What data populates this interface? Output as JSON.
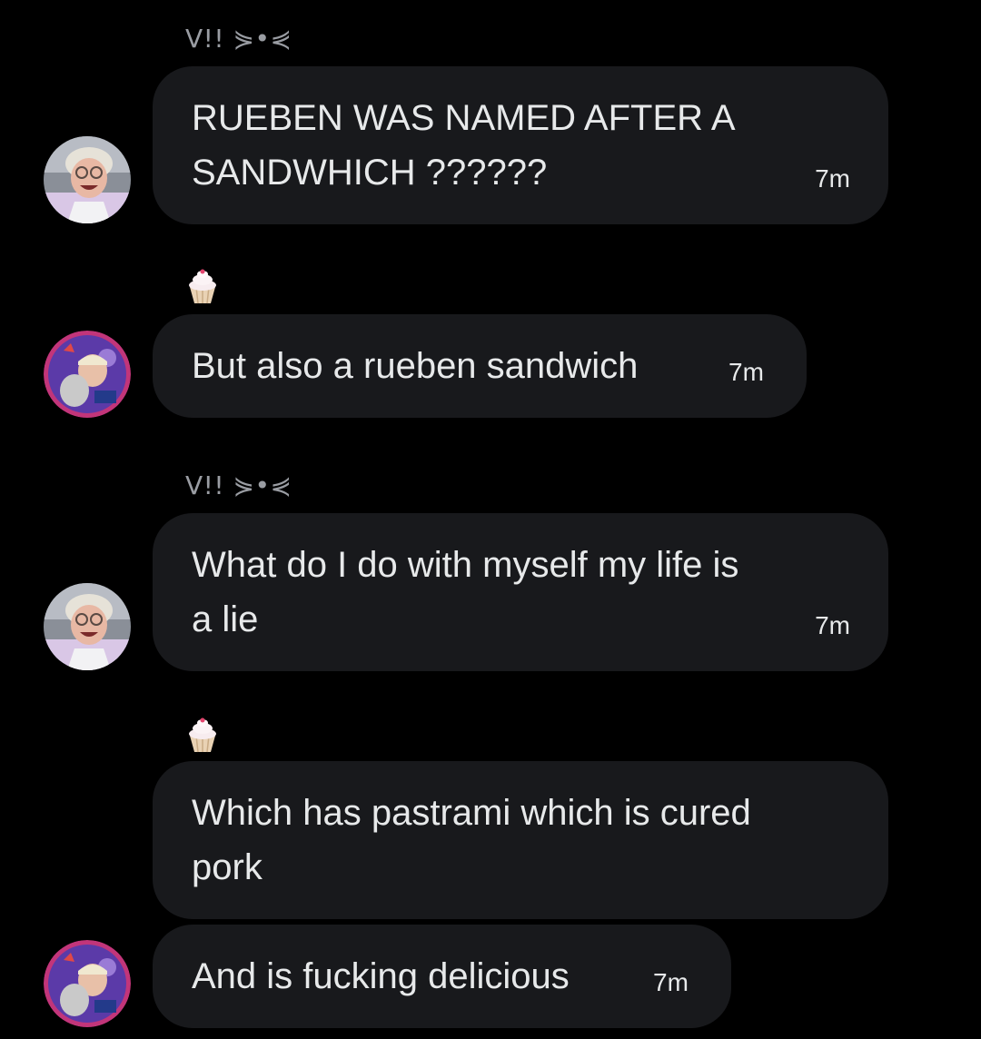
{
  "conversation": {
    "messages": [
      {
        "sender": "V!! ⋟•⋞",
        "text": "RUEBEN WAS NAMED AFTER A\nSANDWHICH ??????",
        "time": "7m"
      },
      {
        "sender_icon": "cupcake-icon",
        "text": "But also a rueben sandwich",
        "time": "7m"
      },
      {
        "sender": "V!! ⋟•⋞",
        "text": "What do I do with myself my life is\na lie",
        "time": "7m"
      },
      {
        "sender_icon": "cupcake-icon",
        "text": "Which has pastrami which is cured\npork"
      },
      {
        "text": "And is fucking delicious",
        "time": "7m"
      }
    ]
  },
  "colors": {
    "background": "#000000",
    "bubble": "#18191c",
    "text": "#e7e9ea",
    "sender_name": "#9a9da3"
  }
}
